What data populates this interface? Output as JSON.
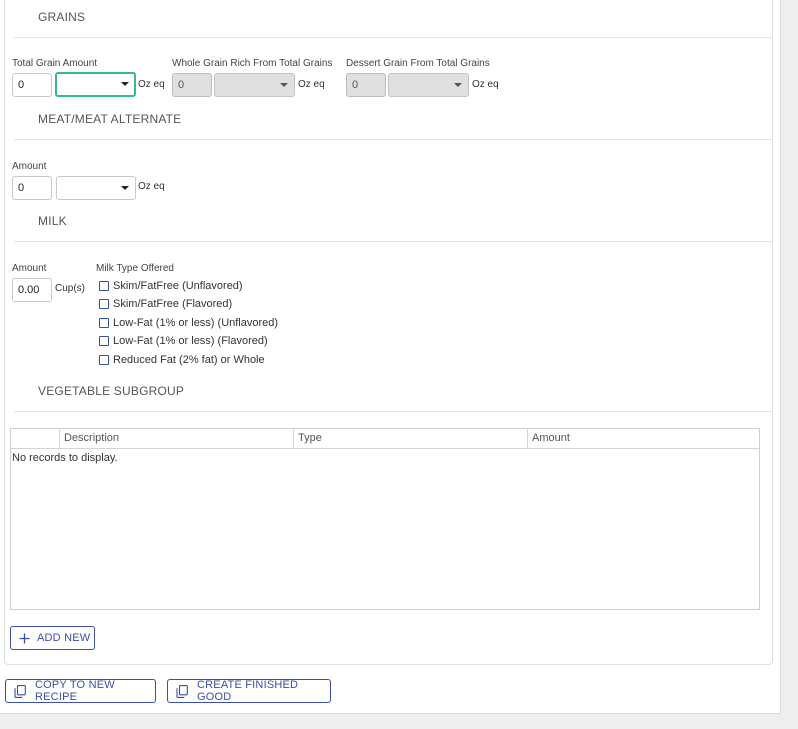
{
  "grains": {
    "title": "GRAINS",
    "total_label": "Total Grain Amount",
    "total_value": "0",
    "total_unit_selected": "",
    "total_unit_text": "Oz eq",
    "whole_label": "Whole Grain Rich From Total Grains",
    "whole_value": "0",
    "whole_unit_selected": "",
    "whole_unit_text": "Oz eq",
    "dessert_label": "Dessert Grain From Total Grains",
    "dessert_value": "0",
    "dessert_unit_selected": "",
    "dessert_unit_text": "Oz eq"
  },
  "meat": {
    "title": "MEAT/MEAT ALTERNATE",
    "amount_label": "Amount",
    "amount_value": "0",
    "unit_selected": "",
    "unit_text": "Oz eq"
  },
  "milk": {
    "title": "MILK",
    "amount_label": "Amount",
    "amount_value": "0.00",
    "amount_unit": "Cup(s)",
    "type_label": "Milk Type Offered",
    "types": [
      {
        "label": "Skim/FatFree (Unflavored)",
        "checked": false
      },
      {
        "label": "Skim/FatFree (Flavored)",
        "checked": false
      },
      {
        "label": "Low-Fat (1% or less) (Unflavored)",
        "checked": false
      },
      {
        "label": "Low-Fat (1% or less) (Flavored)",
        "checked": false
      },
      {
        "label": "Reduced Fat (2% fat) or Whole",
        "checked": false
      }
    ]
  },
  "vegetable": {
    "title": "VEGETABLE SUBGROUP",
    "columns": [
      "",
      "Description",
      "Type",
      "Amount"
    ],
    "rows": [],
    "empty_text": "No records to display.",
    "add_label": "ADD NEW"
  },
  "actions": {
    "copy_label": "COPY TO NEW RECIPE",
    "create_label": "CREATE FINISHED GOOD"
  },
  "icons": {
    "add": "plus-icon",
    "copy": "copy-icon",
    "dropdown": "caret-down-icon"
  },
  "colors": {
    "accent": "#3b4ea8",
    "focus": "#2ebc94",
    "disabled": "#e0e0e0"
  }
}
